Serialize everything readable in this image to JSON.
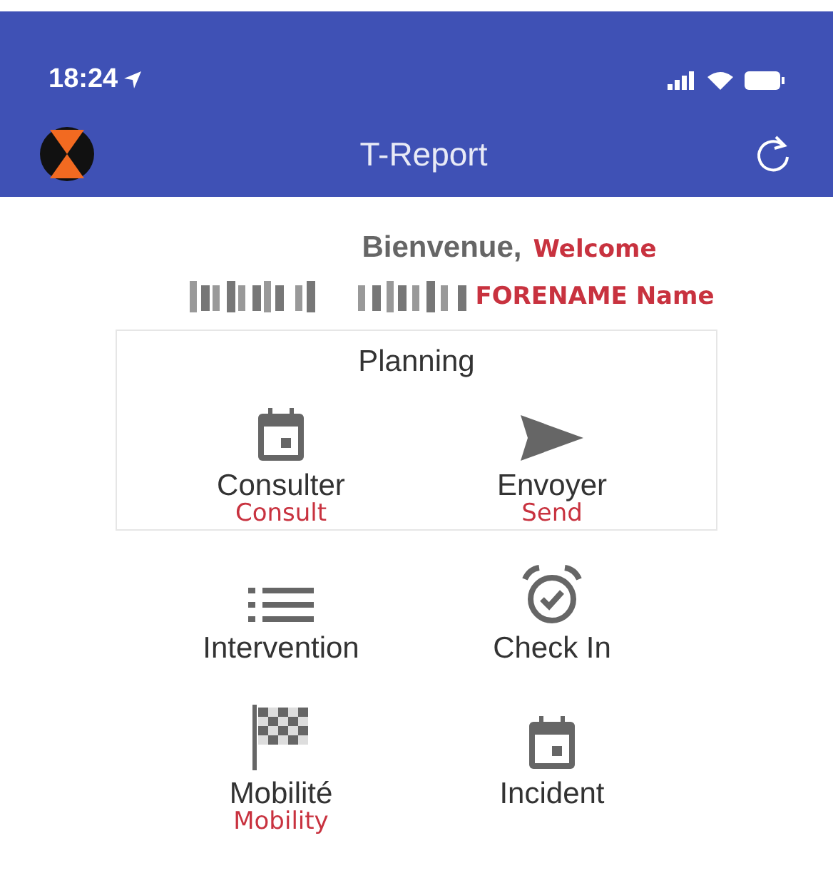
{
  "status_bar": {
    "time": "18:24"
  },
  "header": {
    "title": "T-Report"
  },
  "welcome": {
    "greeting": "Bienvenue,",
    "greeting_translation": "Welcome",
    "name_translation": "FORENAME Name"
  },
  "planning": {
    "title": "Planning",
    "items": [
      {
        "label": "Consulter",
        "translation": "Consult",
        "kind": "calendar"
      },
      {
        "label": "Envoyer",
        "translation": "Send",
        "kind": "send"
      }
    ]
  },
  "menu": [
    {
      "label": "Intervention",
      "kind": "list"
    },
    {
      "label": "Check In",
      "kind": "alarm"
    },
    {
      "label": "Mobilité",
      "translation": "Mobility",
      "kind": "flag"
    },
    {
      "label": "Incident",
      "kind": "calendar"
    }
  ]
}
